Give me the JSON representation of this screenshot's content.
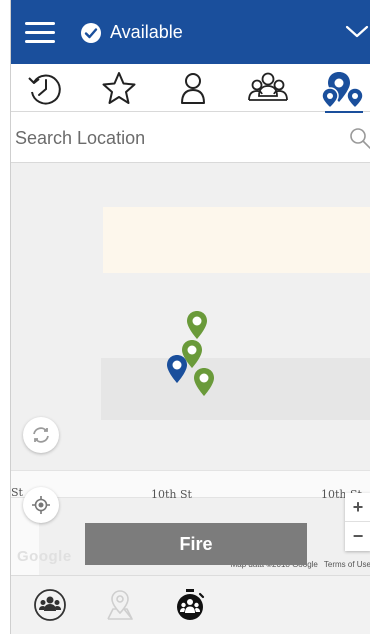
{
  "header": {
    "status": "Available",
    "accent_color": "#1a4f9c",
    "menu_icon": "hamburger-icon",
    "status_icon": "check-circle-icon",
    "dropdown_icon": "chevron-down-icon"
  },
  "tabs": [
    {
      "icon": "history-icon",
      "active": false
    },
    {
      "icon": "star-icon",
      "active": false
    },
    {
      "icon": "person-icon",
      "active": false
    },
    {
      "icon": "group-icon",
      "active": false
    },
    {
      "icon": "location-pins-icon",
      "active": true
    }
  ],
  "search": {
    "placeholder": "Search Location",
    "icon": "search-icon"
  },
  "map": {
    "streets": [
      "10th St",
      "10th St",
      "St"
    ],
    "logo": "Google",
    "attribution": "Map data ©2018 Google",
    "terms": "Terms of Use",
    "zoom_in": "+",
    "zoom_out": "−",
    "pins": [
      {
        "color": "#6a9a3a"
      },
      {
        "color": "#6a9a3a"
      },
      {
        "color": "#1a4f9c"
      },
      {
        "color": "#6a9a3a"
      }
    ]
  },
  "action": {
    "fire_label": "Fire"
  },
  "bottom_nav": [
    {
      "icon": "group-circle-icon"
    },
    {
      "icon": "map-pin-icon"
    },
    {
      "icon": "stopwatch-group-icon"
    }
  ]
}
